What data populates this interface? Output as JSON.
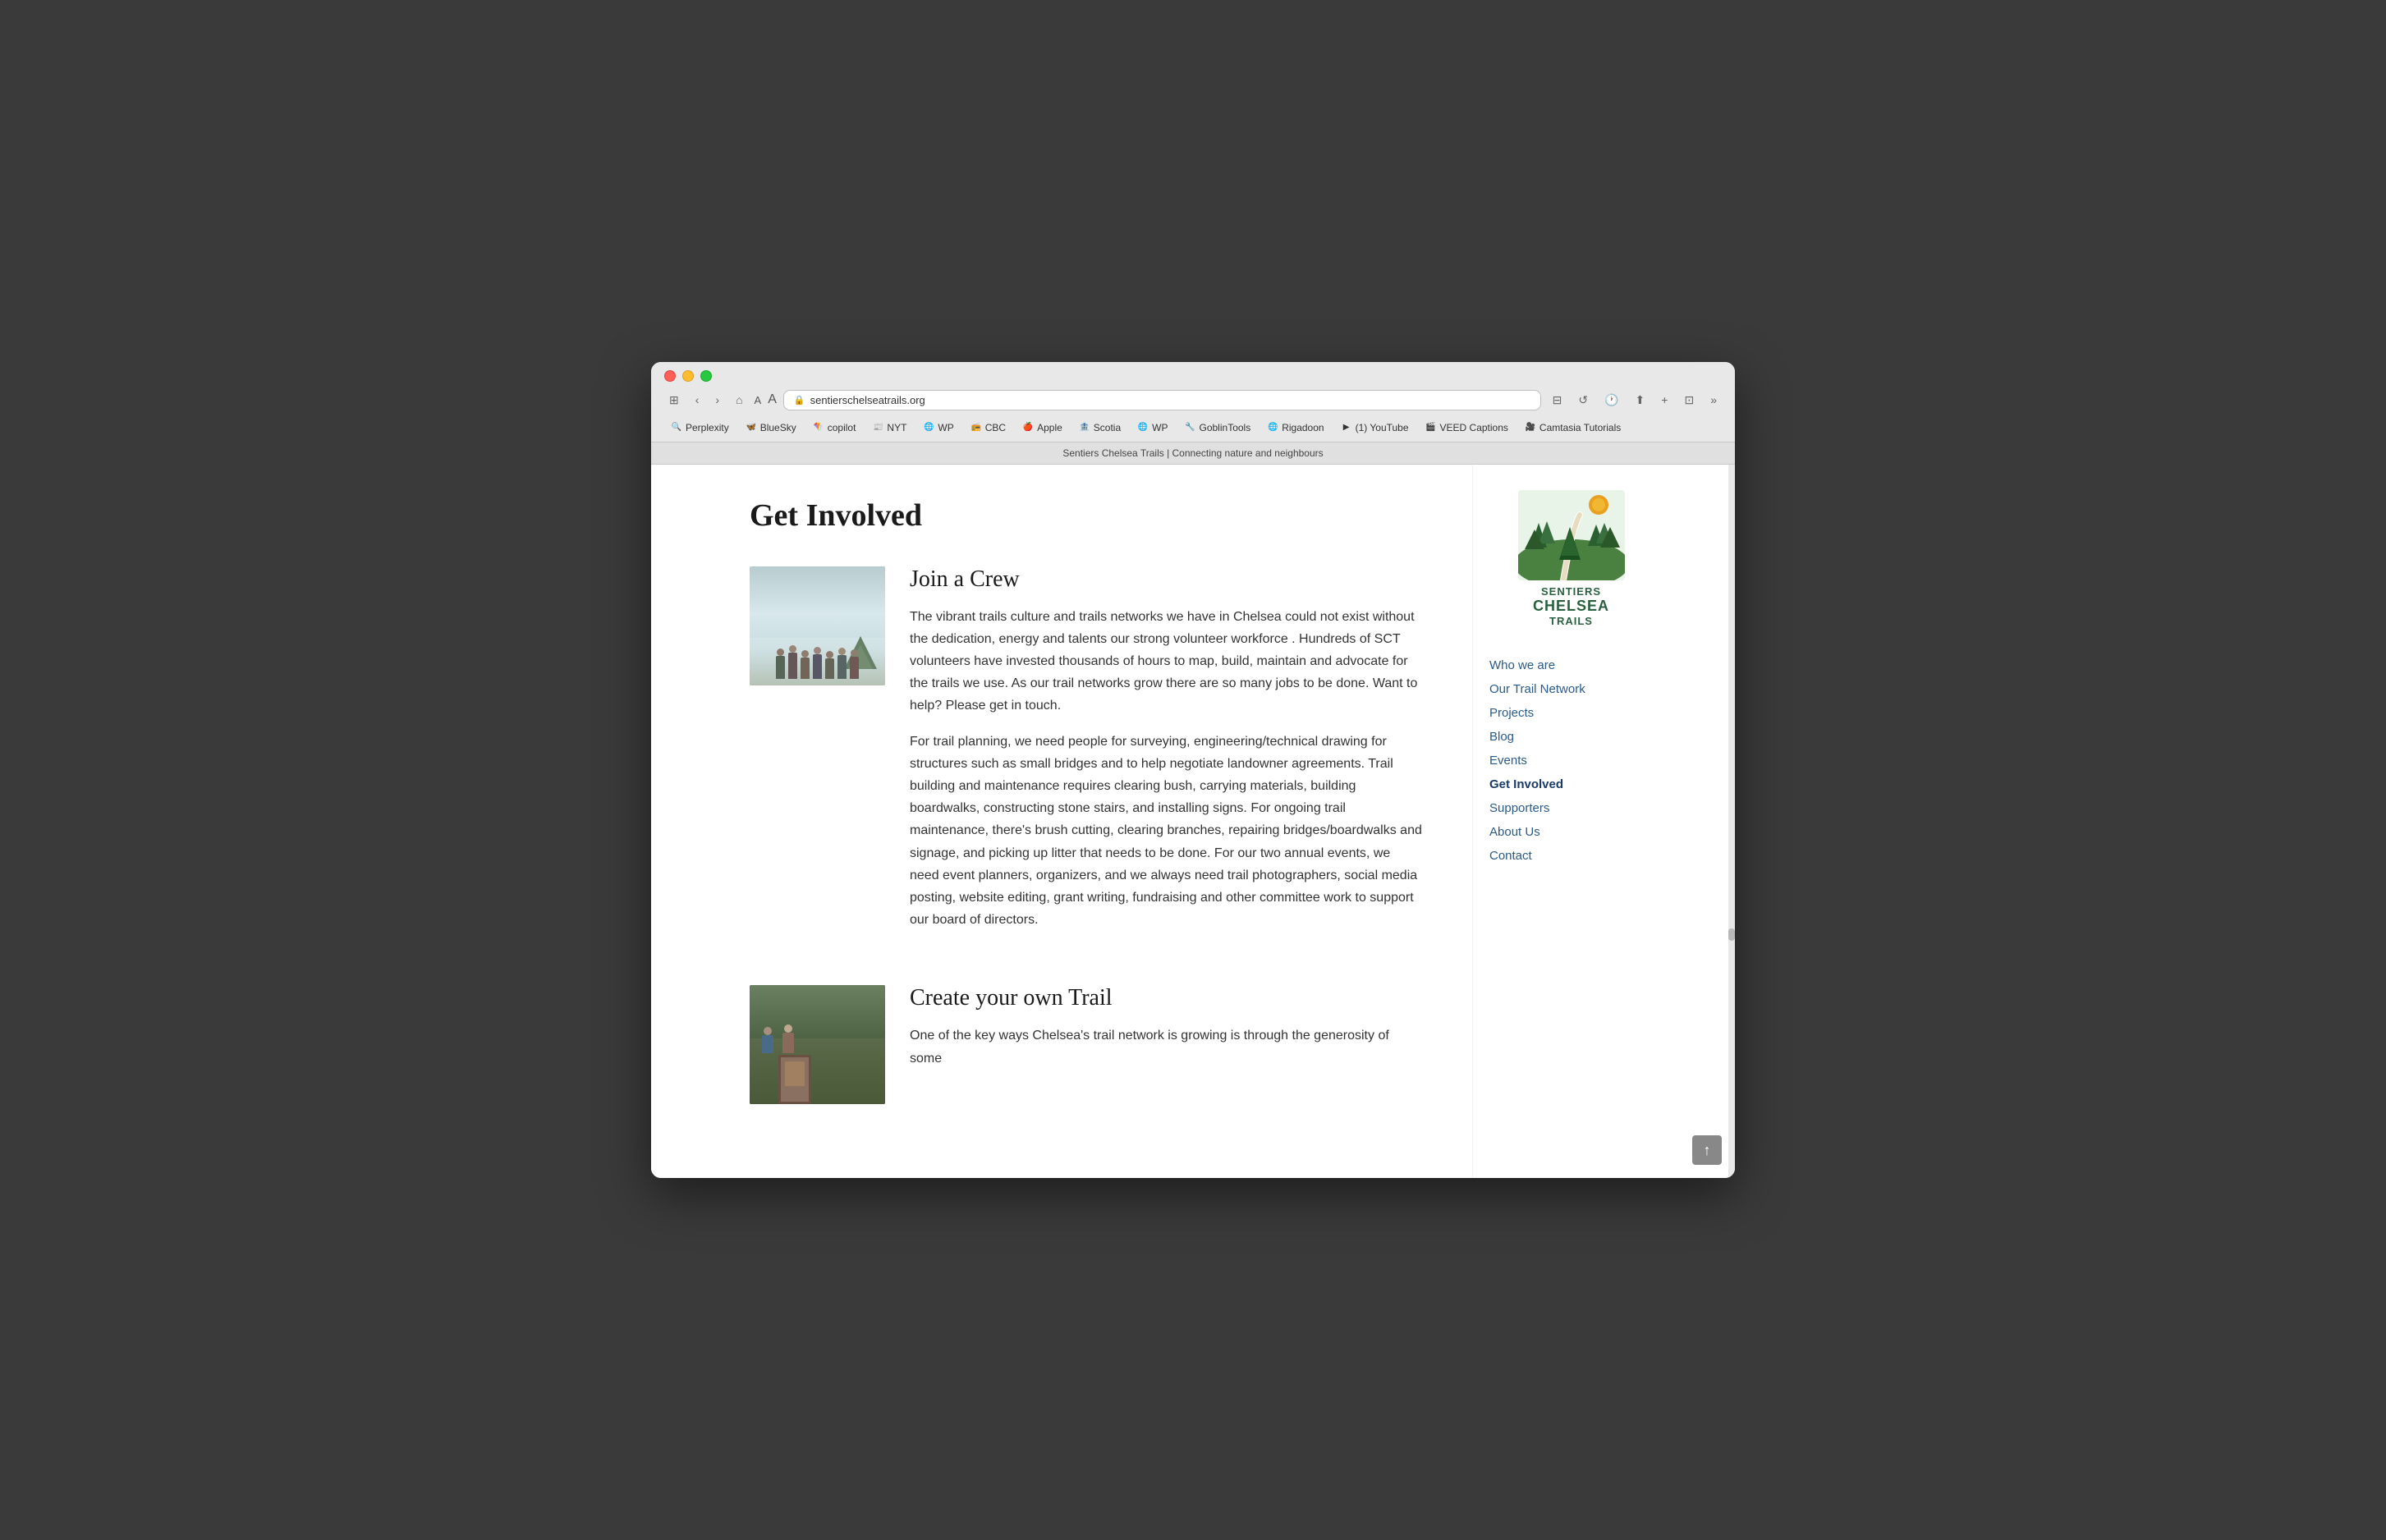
{
  "browser": {
    "url": "sentierschelseatrails.org",
    "tab_title": "Sentiers Chelsea Trails | Connecting nature and neighbours"
  },
  "bookmarks": [
    {
      "label": "Perplexity",
      "icon": "🔍"
    },
    {
      "label": "BlueSky",
      "icon": "🦋"
    },
    {
      "label": "copilot",
      "icon": "🪁"
    },
    {
      "label": "NYT",
      "icon": "📰"
    },
    {
      "label": "WP",
      "icon": "🌐"
    },
    {
      "label": "CBC",
      "icon": "📻"
    },
    {
      "label": "Apple",
      "icon": "🍎"
    },
    {
      "label": "Scotia",
      "icon": "🏦"
    },
    {
      "label": "WP",
      "icon": "🌐"
    },
    {
      "label": "GoblinTools",
      "icon": "🔧"
    },
    {
      "label": "Rigadoon",
      "icon": "🌐"
    },
    {
      "label": "(1) YouTube",
      "icon": "▶️"
    },
    {
      "label": "VEED Captions",
      "icon": "🎬"
    },
    {
      "label": "Camtasia Tutorials",
      "icon": "🎥"
    }
  ],
  "page": {
    "title": "Get Involved",
    "subtitle": "Sentiers Chelsea Trails | Connecting nature and neighbours"
  },
  "sections": [
    {
      "id": "join-crew",
      "title": "Join a Crew",
      "paragraphs": [
        "The vibrant trails culture and trails networks we have in Chelsea could not exist without the dedication, energy and talents our strong volunteer workforce . Hundreds of SCT volunteers have invested thousands of hours to map, build, maintain and advocate for the trails we use. As our trail networks grow there are so many jobs to be done. Want to help?  Please get in touch.",
        "For trail planning, we need people for surveying, engineering/technical drawing for structures such as small bridges and to help negotiate landowner agreements.  Trail building and maintenance requires clearing bush, carrying materials, building boardwalks, constructing stone stairs, and installing signs.  For ongoing trail maintenance, there's brush cutting, clearing branches, repairing bridges/boardwalks and signage, and picking up litter that needs to be done. For our two annual events,  we need event planners, organizers,  and we always need trail photographers, social media posting, website editing, grant writing, fundraising and other committee work to support our board of directors."
      ]
    },
    {
      "id": "create-trail",
      "title": "Create your own Trail",
      "paragraphs": [
        "One of the key ways Chelsea's trail network is growing is through the generosity of some"
      ]
    }
  ],
  "sidebar": {
    "logo": {
      "text_sentiers": "SENTIERS",
      "text_chelsea": "CHELSEA",
      "text_trails": "TRAILS"
    },
    "nav_items": [
      {
        "label": "Who we are",
        "href": "#",
        "active": false
      },
      {
        "label": "Our Trail Network",
        "href": "#",
        "active": false
      },
      {
        "label": "Projects",
        "href": "#",
        "active": false
      },
      {
        "label": "Blog",
        "href": "#",
        "active": false
      },
      {
        "label": "Events",
        "href": "#",
        "active": false
      },
      {
        "label": "Get Involved",
        "href": "#",
        "active": true
      },
      {
        "label": "Supporters",
        "href": "#",
        "active": false
      },
      {
        "label": "About Us",
        "href": "#",
        "active": false
      },
      {
        "label": "Contact",
        "href": "#",
        "active": false
      }
    ]
  },
  "scroll_top_label": "↑"
}
